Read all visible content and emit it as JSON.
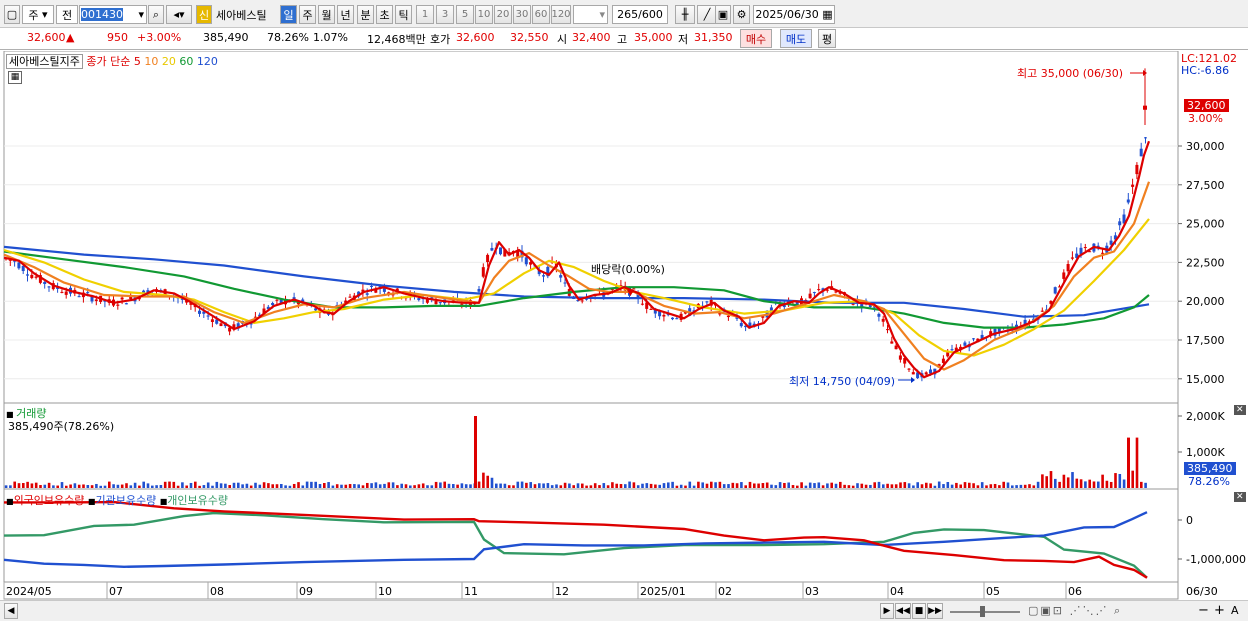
{
  "toolbar": {
    "type_code": "주",
    "period_code": "전",
    "stock_code": "001430",
    "credit_badge": "신",
    "stock_name": "세아베스틸",
    "periods": [
      "일",
      "주",
      "월",
      "년",
      "분",
      "초",
      "틱"
    ],
    "intervals": [
      "1",
      "3",
      "5",
      "10",
      "20",
      "30",
      "60",
      "120"
    ],
    "count": "265",
    "count_max": "/600",
    "date": "2025/06/30"
  },
  "quote": {
    "price": "32,600",
    "arrow": "▲",
    "change": "950",
    "change_pct": "+3.00%",
    "volume": "385,490",
    "volume_ratio": "78.26%",
    "turnover": "1.07%",
    "amount": "12,468백만",
    "bid_label": "호가",
    "bid": "32,600",
    "ask": "32,550",
    "open_label": "시",
    "open": "32,400",
    "high_label": "고",
    "high": "35,000",
    "low_label": "저",
    "low": "31,350",
    "buy_button": "매수",
    "sell_button": "매도",
    "eval_button": "평"
  },
  "legend": {
    "name": "세아베스틸지주",
    "ma_label": "종가 단순",
    "ma": [
      {
        "period": "5",
        "color": "#dd0000"
      },
      {
        "period": "10",
        "color": "#f08020"
      },
      {
        "period": "20",
        "color": "#e8d000"
      },
      {
        "period": "60",
        "color": "#119933"
      },
      {
        "period": "120",
        "color": "#2050d0"
      }
    ]
  },
  "price_axis": {
    "lc": "LC:121.02",
    "hc": "HC:-6.86",
    "ticks": [
      "30,000",
      "27,500",
      "25,000",
      "22,500",
      "20,000",
      "17,500",
      "15,000"
    ],
    "current": "32,600",
    "current_pct": "3.00%"
  },
  "annotations": {
    "high": "최고 35,000 (06/30)",
    "low": "최저 14,750 (04/09)",
    "dividend": "배당락(0.00%)"
  },
  "volume_panel": {
    "title": "거래량",
    "summary": "385,490주(78.26%)",
    "ticks": [
      "2,000K",
      "1,000K"
    ],
    "current": "385,490",
    "current_pct": "78.26%"
  },
  "holdings_panel": {
    "series": [
      {
        "name": "외국인보유수량",
        "color": "#dd0000"
      },
      {
        "name": "기관보유수량",
        "color": "#2050d0"
      },
      {
        "name": "개인보유수량",
        "color": "#339966"
      }
    ],
    "ticks": [
      "0",
      "-1,000,000"
    ]
  },
  "time_axis": {
    "labels": [
      "2024/05",
      "07",
      "08",
      "09",
      "10",
      "11",
      "12",
      "2025/01",
      "02",
      "03",
      "04",
      "05",
      "06"
    ],
    "last": "06/30"
  },
  "chart_data": {
    "type": "line",
    "title": "세아베스틸지주",
    "series": [
      {
        "name": "5",
        "values": [
          [
            0,
            22800
          ],
          [
            15,
            22600
          ],
          [
            30,
            21800
          ],
          [
            50,
            21000
          ],
          [
            70,
            20600
          ],
          [
            90,
            20300
          ],
          [
            110,
            19900
          ],
          [
            130,
            20100
          ],
          [
            150,
            20700
          ],
          [
            170,
            20500
          ],
          [
            185,
            20000
          ],
          [
            200,
            19400
          ],
          [
            215,
            18800
          ],
          [
            230,
            18200
          ],
          [
            250,
            18700
          ],
          [
            270,
            19700
          ],
          [
            290,
            20100
          ],
          [
            310,
            19700
          ],
          [
            320,
            19300
          ],
          [
            330,
            19200
          ],
          [
            345,
            20000
          ],
          [
            360,
            20600
          ],
          [
            380,
            20900
          ],
          [
            400,
            20500
          ],
          [
            420,
            20200
          ],
          [
            440,
            20000
          ],
          [
            460,
            19900
          ],
          [
            475,
            19900
          ],
          [
            485,
            22300
          ],
          [
            495,
            23800
          ],
          [
            505,
            23000
          ],
          [
            515,
            23300
          ],
          [
            525,
            22800
          ],
          [
            535,
            22000
          ],
          [
            545,
            21700
          ],
          [
            555,
            22500
          ],
          [
            565,
            21000
          ],
          [
            575,
            20100
          ],
          [
            590,
            20400
          ],
          [
            605,
            20500
          ],
          [
            620,
            20900
          ],
          [
            635,
            20500
          ],
          [
            650,
            19500
          ],
          [
            665,
            19200
          ],
          [
            680,
            18900
          ],
          [
            695,
            19500
          ],
          [
            710,
            19900
          ],
          [
            720,
            19400
          ],
          [
            735,
            19000
          ],
          [
            745,
            18300
          ],
          [
            760,
            18600
          ],
          [
            775,
            19700
          ],
          [
            790,
            20000
          ],
          [
            805,
            19900
          ],
          [
            815,
            20500
          ],
          [
            825,
            20900
          ],
          [
            840,
            20500
          ],
          [
            855,
            19900
          ],
          [
            870,
            19800
          ],
          [
            880,
            19200
          ],
          [
            890,
            17600
          ],
          [
            900,
            16500
          ],
          [
            910,
            15700
          ],
          [
            920,
            15100
          ],
          [
            935,
            15500
          ],
          [
            950,
            16700
          ],
          [
            970,
            17300
          ],
          [
            990,
            17900
          ],
          [
            1010,
            18200
          ],
          [
            1030,
            18700
          ],
          [
            1045,
            19400
          ],
          [
            1060,
            21200
          ],
          [
            1075,
            22900
          ],
          [
            1090,
            23500
          ],
          [
            1105,
            23300
          ],
          [
            1115,
            24200
          ],
          [
            1125,
            25500
          ],
          [
            1135,
            28000
          ],
          [
            1140,
            29400
          ],
          [
            1145,
            30300
          ]
        ]
      },
      {
        "name": "10",
        "values": [
          [
            0,
            23000
          ],
          [
            30,
            22200
          ],
          [
            60,
            21200
          ],
          [
            100,
            20400
          ],
          [
            140,
            20300
          ],
          [
            180,
            20300
          ],
          [
            210,
            19300
          ],
          [
            240,
            18600
          ],
          [
            270,
            19300
          ],
          [
            300,
            19800
          ],
          [
            330,
            19600
          ],
          [
            360,
            20200
          ],
          [
            400,
            20600
          ],
          [
            440,
            20200
          ],
          [
            475,
            19900
          ],
          [
            490,
            21500
          ],
          [
            505,
            22600
          ],
          [
            525,
            23100
          ],
          [
            545,
            22300
          ],
          [
            565,
            21600
          ],
          [
            585,
            20800
          ],
          [
            605,
            20600
          ],
          [
            630,
            20600
          ],
          [
            660,
            19700
          ],
          [
            690,
            19200
          ],
          [
            715,
            19300
          ],
          [
            740,
            18900
          ],
          [
            770,
            19200
          ],
          [
            800,
            19800
          ],
          [
            830,
            20400
          ],
          [
            860,
            20000
          ],
          [
            880,
            19500
          ],
          [
            900,
            17900
          ],
          [
            920,
            16300
          ],
          [
            940,
            15600
          ],
          [
            960,
            16200
          ],
          [
            990,
            17500
          ],
          [
            1020,
            18300
          ],
          [
            1050,
            19700
          ],
          [
            1070,
            21600
          ],
          [
            1090,
            22800
          ],
          [
            1110,
            23200
          ],
          [
            1130,
            25000
          ],
          [
            1145,
            27700
          ]
        ]
      },
      {
        "name": "20",
        "values": [
          [
            0,
            23300
          ],
          [
            40,
            22500
          ],
          [
            80,
            21400
          ],
          [
            120,
            20600
          ],
          [
            160,
            20400
          ],
          [
            190,
            20100
          ],
          [
            220,
            19300
          ],
          [
            250,
            18600
          ],
          [
            280,
            18900
          ],
          [
            310,
            19300
          ],
          [
            340,
            19500
          ],
          [
            380,
            20100
          ],
          [
            420,
            20400
          ],
          [
            460,
            20100
          ],
          [
            490,
            20500
          ],
          [
            520,
            21800
          ],
          [
            545,
            22600
          ],
          [
            570,
            22200
          ],
          [
            600,
            21300
          ],
          [
            630,
            20600
          ],
          [
            660,
            20200
          ],
          [
            700,
            19600
          ],
          [
            740,
            19200
          ],
          [
            780,
            19400
          ],
          [
            820,
            19900
          ],
          [
            860,
            20000
          ],
          [
            890,
            19200
          ],
          [
            915,
            17800
          ],
          [
            940,
            16800
          ],
          [
            970,
            16500
          ],
          [
            1000,
            17200
          ],
          [
            1030,
            18200
          ],
          [
            1060,
            19400
          ],
          [
            1090,
            21300
          ],
          [
            1120,
            23300
          ],
          [
            1145,
            25300
          ]
        ]
      },
      {
        "name": "60",
        "values": [
          [
            0,
            23200
          ],
          [
            60,
            22700
          ],
          [
            120,
            22200
          ],
          [
            180,
            21600
          ],
          [
            230,
            20800
          ],
          [
            280,
            20100
          ],
          [
            330,
            19600
          ],
          [
            380,
            19600
          ],
          [
            430,
            19700
          ],
          [
            475,
            19700
          ],
          [
            520,
            20200
          ],
          [
            570,
            20600
          ],
          [
            620,
            20900
          ],
          [
            670,
            20900
          ],
          [
            720,
            20700
          ],
          [
            760,
            20000
          ],
          [
            810,
            19600
          ],
          [
            860,
            19600
          ],
          [
            900,
            19200
          ],
          [
            940,
            18600
          ],
          [
            980,
            18300
          ],
          [
            1020,
            18300
          ],
          [
            1060,
            18500
          ],
          [
            1100,
            18900
          ],
          [
            1130,
            19600
          ],
          [
            1145,
            20400
          ]
        ]
      },
      {
        "name": "120",
        "values": [
          [
            0,
            23500
          ],
          [
            80,
            23000
          ],
          [
            150,
            22700
          ],
          [
            220,
            22300
          ],
          [
            300,
            21600
          ],
          [
            380,
            21000
          ],
          [
            450,
            20600
          ],
          [
            520,
            20300
          ],
          [
            600,
            20200
          ],
          [
            680,
            20200
          ],
          [
            760,
            20100
          ],
          [
            830,
            19900
          ],
          [
            900,
            19900
          ],
          [
            960,
            19500
          ],
          [
            1020,
            19000
          ],
          [
            1080,
            19100
          ],
          [
            1145,
            19800
          ]
        ]
      }
    ],
    "volume_spikes": [
      {
        "x": 480,
        "volume": 2000000
      },
      {
        "x": 1133,
        "volume": 1400000
      },
      {
        "x": 1145,
        "volume": 385490
      }
    ],
    "ylim": [
      14000,
      36000
    ]
  }
}
